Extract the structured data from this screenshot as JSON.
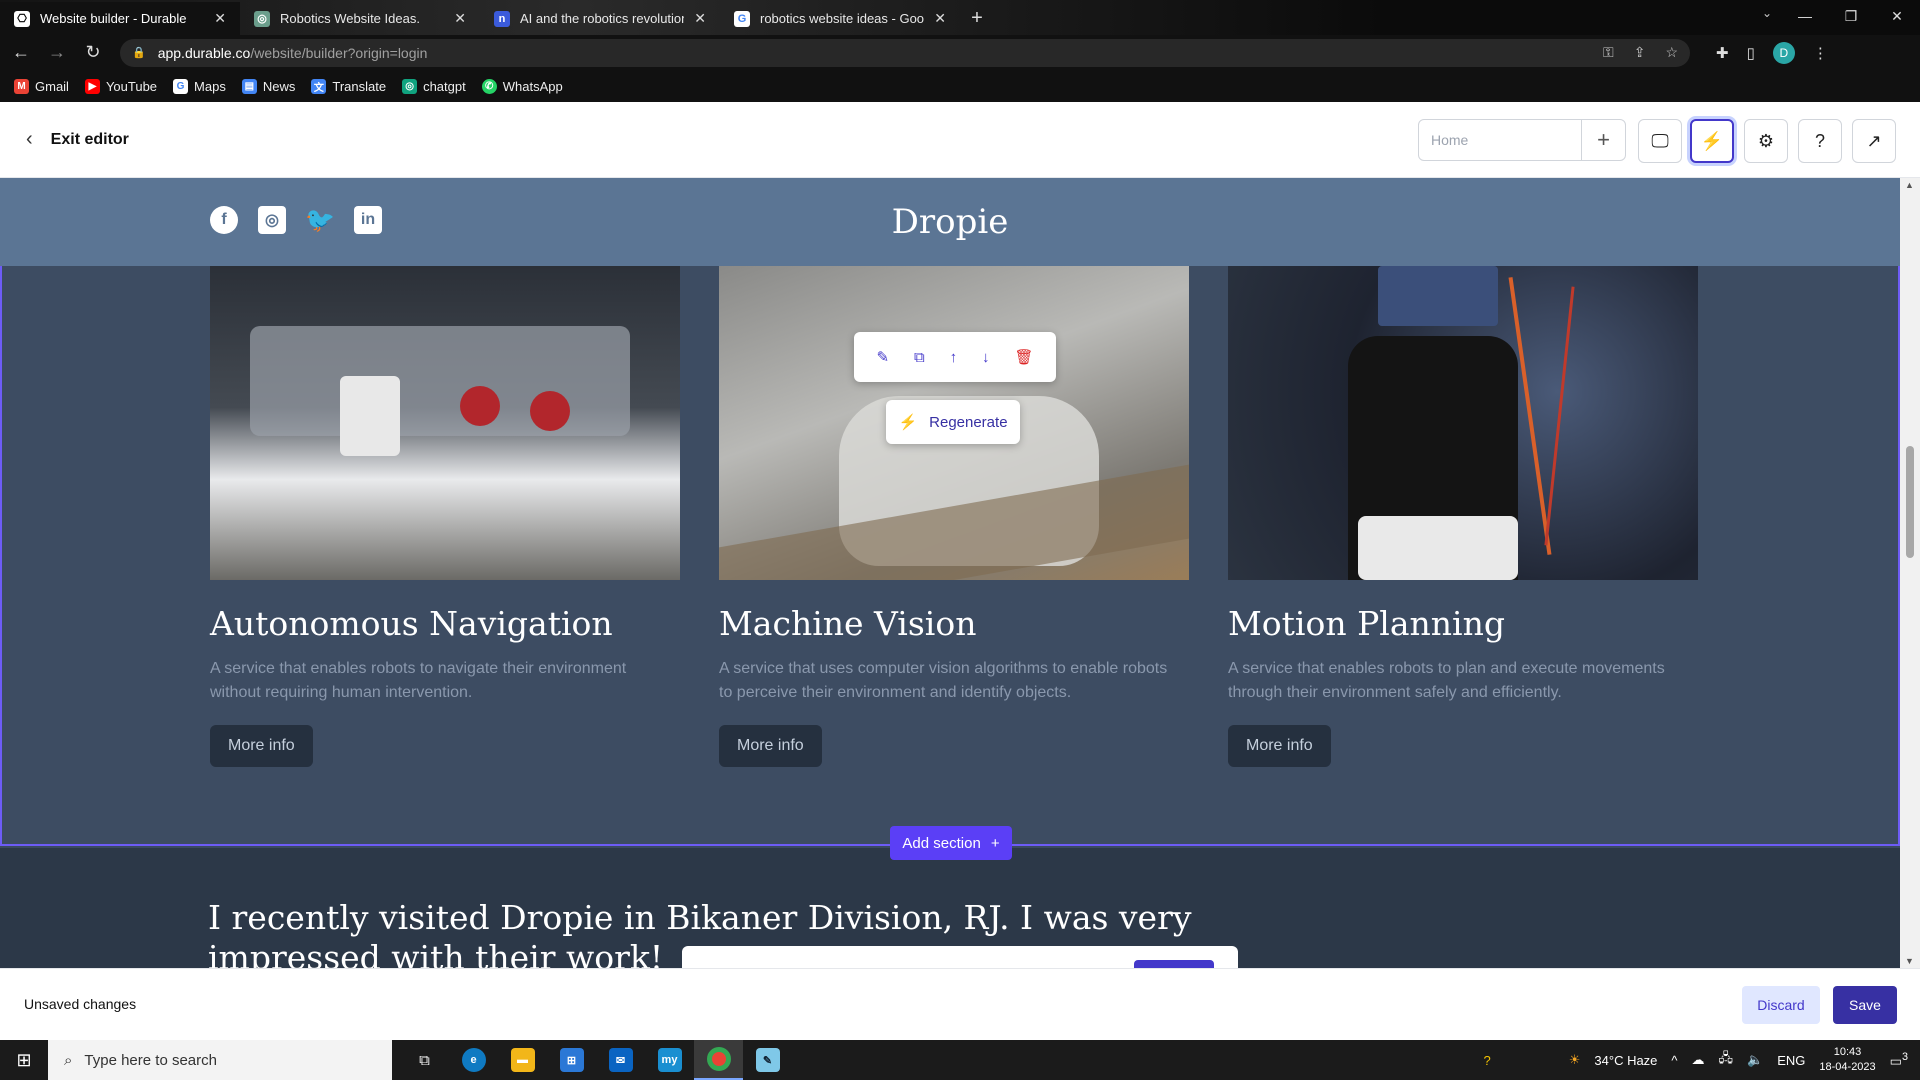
{
  "browser": {
    "tabs": [
      {
        "title": "Website builder - Durable",
        "icon": "durable-icon",
        "active": true
      },
      {
        "title": "Robotics Website Ideas.",
        "icon": "chatgpt-icon",
        "active": false
      },
      {
        "title": "AI and the robotics revolution W",
        "icon": "notion-icon",
        "active": false
      },
      {
        "title": "robotics website ideas - Google",
        "icon": "google-icon",
        "active": false
      }
    ],
    "url_host": "app.durable.co",
    "url_path": "/website/builder?origin=login",
    "profile_initial": "D",
    "bookmarks": [
      {
        "label": "Gmail",
        "icon": "gmail-icon",
        "color": "#ea4335"
      },
      {
        "label": "YouTube",
        "icon": "youtube-icon",
        "color": "#ff0000"
      },
      {
        "label": "Maps",
        "icon": "google-maps-icon",
        "color": "#4285f4"
      },
      {
        "label": "News",
        "icon": "google-news-icon",
        "color": "#4285f4"
      },
      {
        "label": "Translate",
        "icon": "google-translate-icon",
        "color": "#4285f4"
      },
      {
        "label": "chatgpt",
        "icon": "chatgpt-icon",
        "color": "#10a37f"
      },
      {
        "label": "WhatsApp",
        "icon": "whatsapp-icon",
        "color": "#25d366"
      }
    ]
  },
  "editor": {
    "exit_label": "Exit editor",
    "page_select": "Home",
    "unsaved_label": "Unsaved changes",
    "discard_label": "Discard",
    "save_label": "Save",
    "accent": "#3730a3"
  },
  "site": {
    "brand": "Dropie",
    "services": [
      {
        "title": "Autonomous Navigation",
        "desc": "A service that enables robots to navigate their environment without requiring human intervention.",
        "button": "More info"
      },
      {
        "title": "Machine Vision",
        "desc": "A service that uses computer vision algorithms to enable robots to perceive their environment and identify objects.",
        "button": "More info"
      },
      {
        "title": "Motion Planning",
        "desc": "A service that enables robots to plan and execute movements through their environment safely and efficiently.",
        "button": "More info"
      }
    ],
    "regenerate_label": "Regenerate",
    "add_section_label": "Add section",
    "testimonial": "I recently visited Dropie in Bikaner Division, RJ. I was very impressed with their work!"
  },
  "taskbar": {
    "search_placeholder": "Type here to search",
    "weather": "34°C  Haze",
    "lang": "ENG",
    "time": "10:43",
    "date": "18-04-2023",
    "notif_count": "3"
  }
}
